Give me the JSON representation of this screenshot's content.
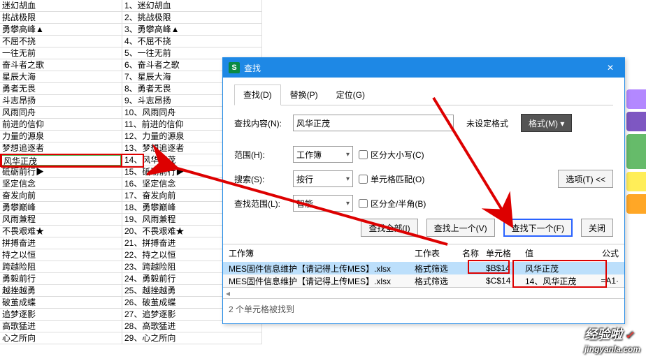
{
  "spreadsheet": {
    "colB": [
      "迷幻胡血",
      "挑战极限",
      "勇攀高峰▲",
      "不屈不挠",
      "一往无前",
      "奋斗者之歌",
      "星辰大海",
      "勇者无畏",
      "斗志昂扬",
      "风雨同舟",
      "前进的信仰",
      "力量的源泉",
      "梦想追逐者",
      "风华正茂",
      "砥砺前行▶",
      "坚定信念",
      "奋发向前",
      "勇攀巅峰",
      "风雨兼程",
      "不畏艰难★",
      "拼搏奋进",
      "持之以恒",
      "跨越险阻",
      "勇毅前行",
      "越挫越勇",
      "破茧成蝶",
      "追梦逐影",
      "高歌猛进",
      "心之所向"
    ],
    "colC": [
      "1、迷幻胡血",
      "2、挑战极限",
      "3、勇攀高峰▲",
      "4、不屈不挠",
      "5、一往无前",
      "6、奋斗者之歌",
      "7、星辰大海",
      "8、勇者无畏",
      "9、斗志昂扬",
      "10、风雨同舟",
      "11、前进的信仰",
      "12、力量的源泉",
      "13、梦想追逐者",
      "14、风华正茂",
      "15、砥砺前行▶",
      "16、坚定信念",
      "17、奋发向前",
      "18、勇攀巅峰",
      "19、风雨兼程",
      "20、不畏艰难★",
      "21、拼搏奋进",
      "22、持之以恒",
      "23、跨越险阻",
      "24、勇毅前行",
      "25、越挫越勇",
      "26、破茧成蝶",
      "27、追梦逐影",
      "28、高歌猛进",
      "29、心之所向"
    ]
  },
  "dialog": {
    "title": "查找",
    "tabs": {
      "find": "查找(D)",
      "replace": "替换(P)",
      "goto": "定位(G)"
    },
    "findLabel": "查找内容(N):",
    "findValue": "风华正茂",
    "noFormatLabel": "未设定格式",
    "formatBtn": "格式(M) ▾",
    "scopeLabel": "范围(H):",
    "scopeValue": "工作簿",
    "caseLabel": "区分大小写(C)",
    "searchLabel": "搜索(S):",
    "searchValue": "按行",
    "matchCellLabel": "单元格匹配(O)",
    "lookinLabel": "查找范围(L):",
    "lookinValue": "智能",
    "widthLabel": "区分全/半角(B)",
    "optionsBtn": "选项(T) <<",
    "findAllBtn": "查找全部(I)",
    "findPrevBtn": "查找上一个(V)",
    "findNextBtn": "查找下一个(F)",
    "closeBtn": "关闭",
    "resultHeaders": {
      "wb": "工作簿",
      "ws": "工作表",
      "name": "名称",
      "cell": "单元格",
      "value": "值",
      "formula": "公式"
    },
    "results": [
      {
        "wb": "MES固件信息维护【请记得上传MES】.xlsx",
        "ws": "格式筛选",
        "name": "",
        "cell": "$B$14",
        "value": "风华正茂",
        "formula": ""
      },
      {
        "wb": "MES固件信息维护【请记得上传MES】.xlsx",
        "ws": "格式筛选",
        "name": "",
        "cell": "$C$14",
        "value": "14、风华正茂",
        "formula": "=A1·"
      }
    ],
    "footer": "2 个单元格被找到"
  },
  "logo": {
    "cn": "经验啦",
    "ck": "✓",
    "en": "jingyanla.com"
  },
  "icons": {
    "close_x": "✕",
    "down": "▾",
    "left": "◂",
    "s": "S"
  }
}
